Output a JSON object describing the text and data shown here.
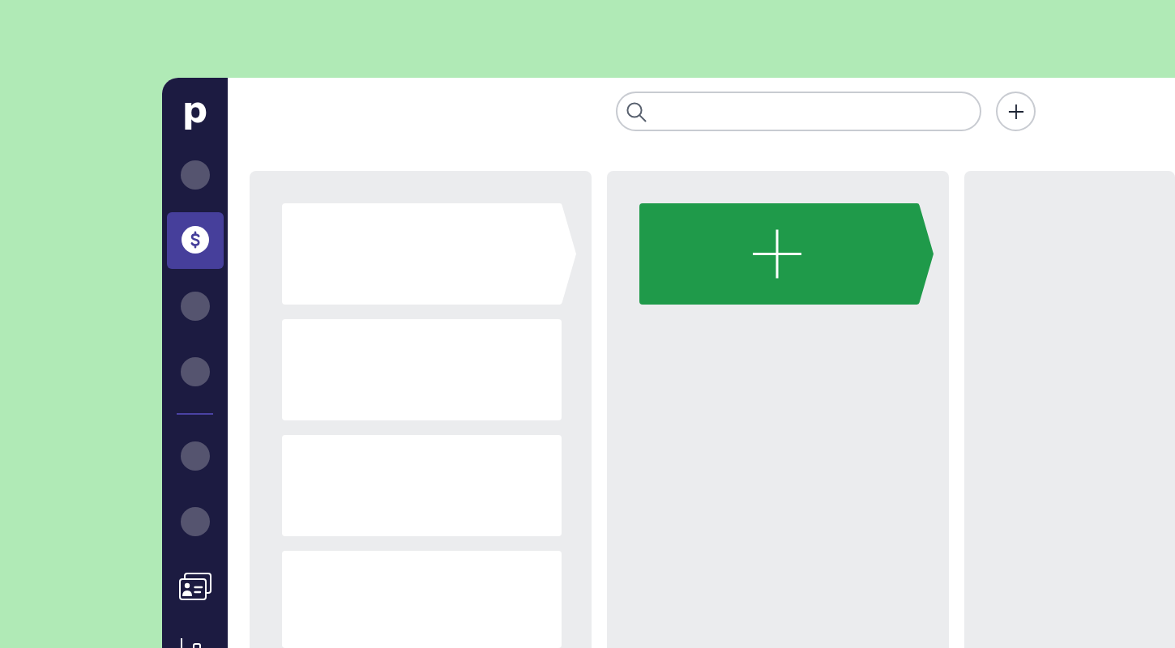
{
  "sidebar": {
    "logo": "p",
    "groups": [
      {
        "items": [
          {
            "kind": "circle",
            "selected": false
          },
          {
            "kind": "dollar",
            "selected": true
          },
          {
            "kind": "circle",
            "selected": false
          },
          {
            "kind": "circle",
            "selected": false
          }
        ]
      },
      {
        "items": [
          {
            "kind": "circle",
            "selected": false
          },
          {
            "kind": "circle",
            "selected": false
          },
          {
            "kind": "contacts",
            "selected": false
          },
          {
            "kind": "chart",
            "selected": false
          }
        ]
      }
    ]
  },
  "board": {
    "columns": [
      {
        "cards": [
          {
            "kind": "stage"
          },
          {
            "kind": "deal"
          },
          {
            "kind": "deal"
          },
          {
            "kind": "deal"
          }
        ]
      },
      {
        "cards": [
          {
            "kind": "add"
          }
        ]
      },
      {}
    ]
  }
}
